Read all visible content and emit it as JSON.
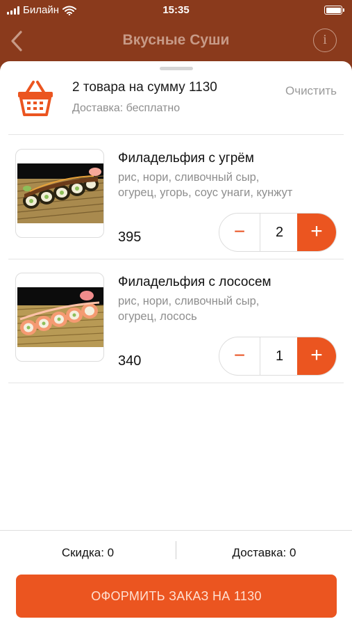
{
  "status_bar": {
    "carrier": "Билайн",
    "time": "15:35"
  },
  "nav": {
    "title": "Вкусные Суши",
    "info_glyph": "i"
  },
  "cart": {
    "summary": "2 товара на сумму 1130",
    "delivery": "Доставка: бесплатно",
    "clear_label": "Очистить"
  },
  "items": [
    {
      "name": "Филадельфия с угрём",
      "desc_line1": "рис, нори, сливочный сыр,",
      "desc_line2": "огурец, угорь, соус унаги, кунжут",
      "price": "395",
      "qty": "2",
      "minus": "−",
      "plus": "+"
    },
    {
      "name": "Филадельфия с лососем",
      "desc_line1": "рис, нори, сливочный сыр,",
      "desc_line2": "огурец, лосось",
      "price": "340",
      "qty": "1",
      "minus": "−",
      "plus": "+"
    }
  ],
  "footer": {
    "discount": "Скидка: 0",
    "delivery": "Доставка: 0",
    "checkout": "ОФОРМИТЬ ЗАКАЗ НА 1130"
  },
  "colors": {
    "brand": "#8a3a1c",
    "accent": "#eb5520",
    "muted": "#8e8e8e"
  },
  "icons": {
    "back": "chevron-left-icon",
    "info": "info-icon",
    "basket": "basket-icon",
    "wifi": "wifi-icon",
    "signal": "signal-icon",
    "battery": "battery-icon"
  }
}
